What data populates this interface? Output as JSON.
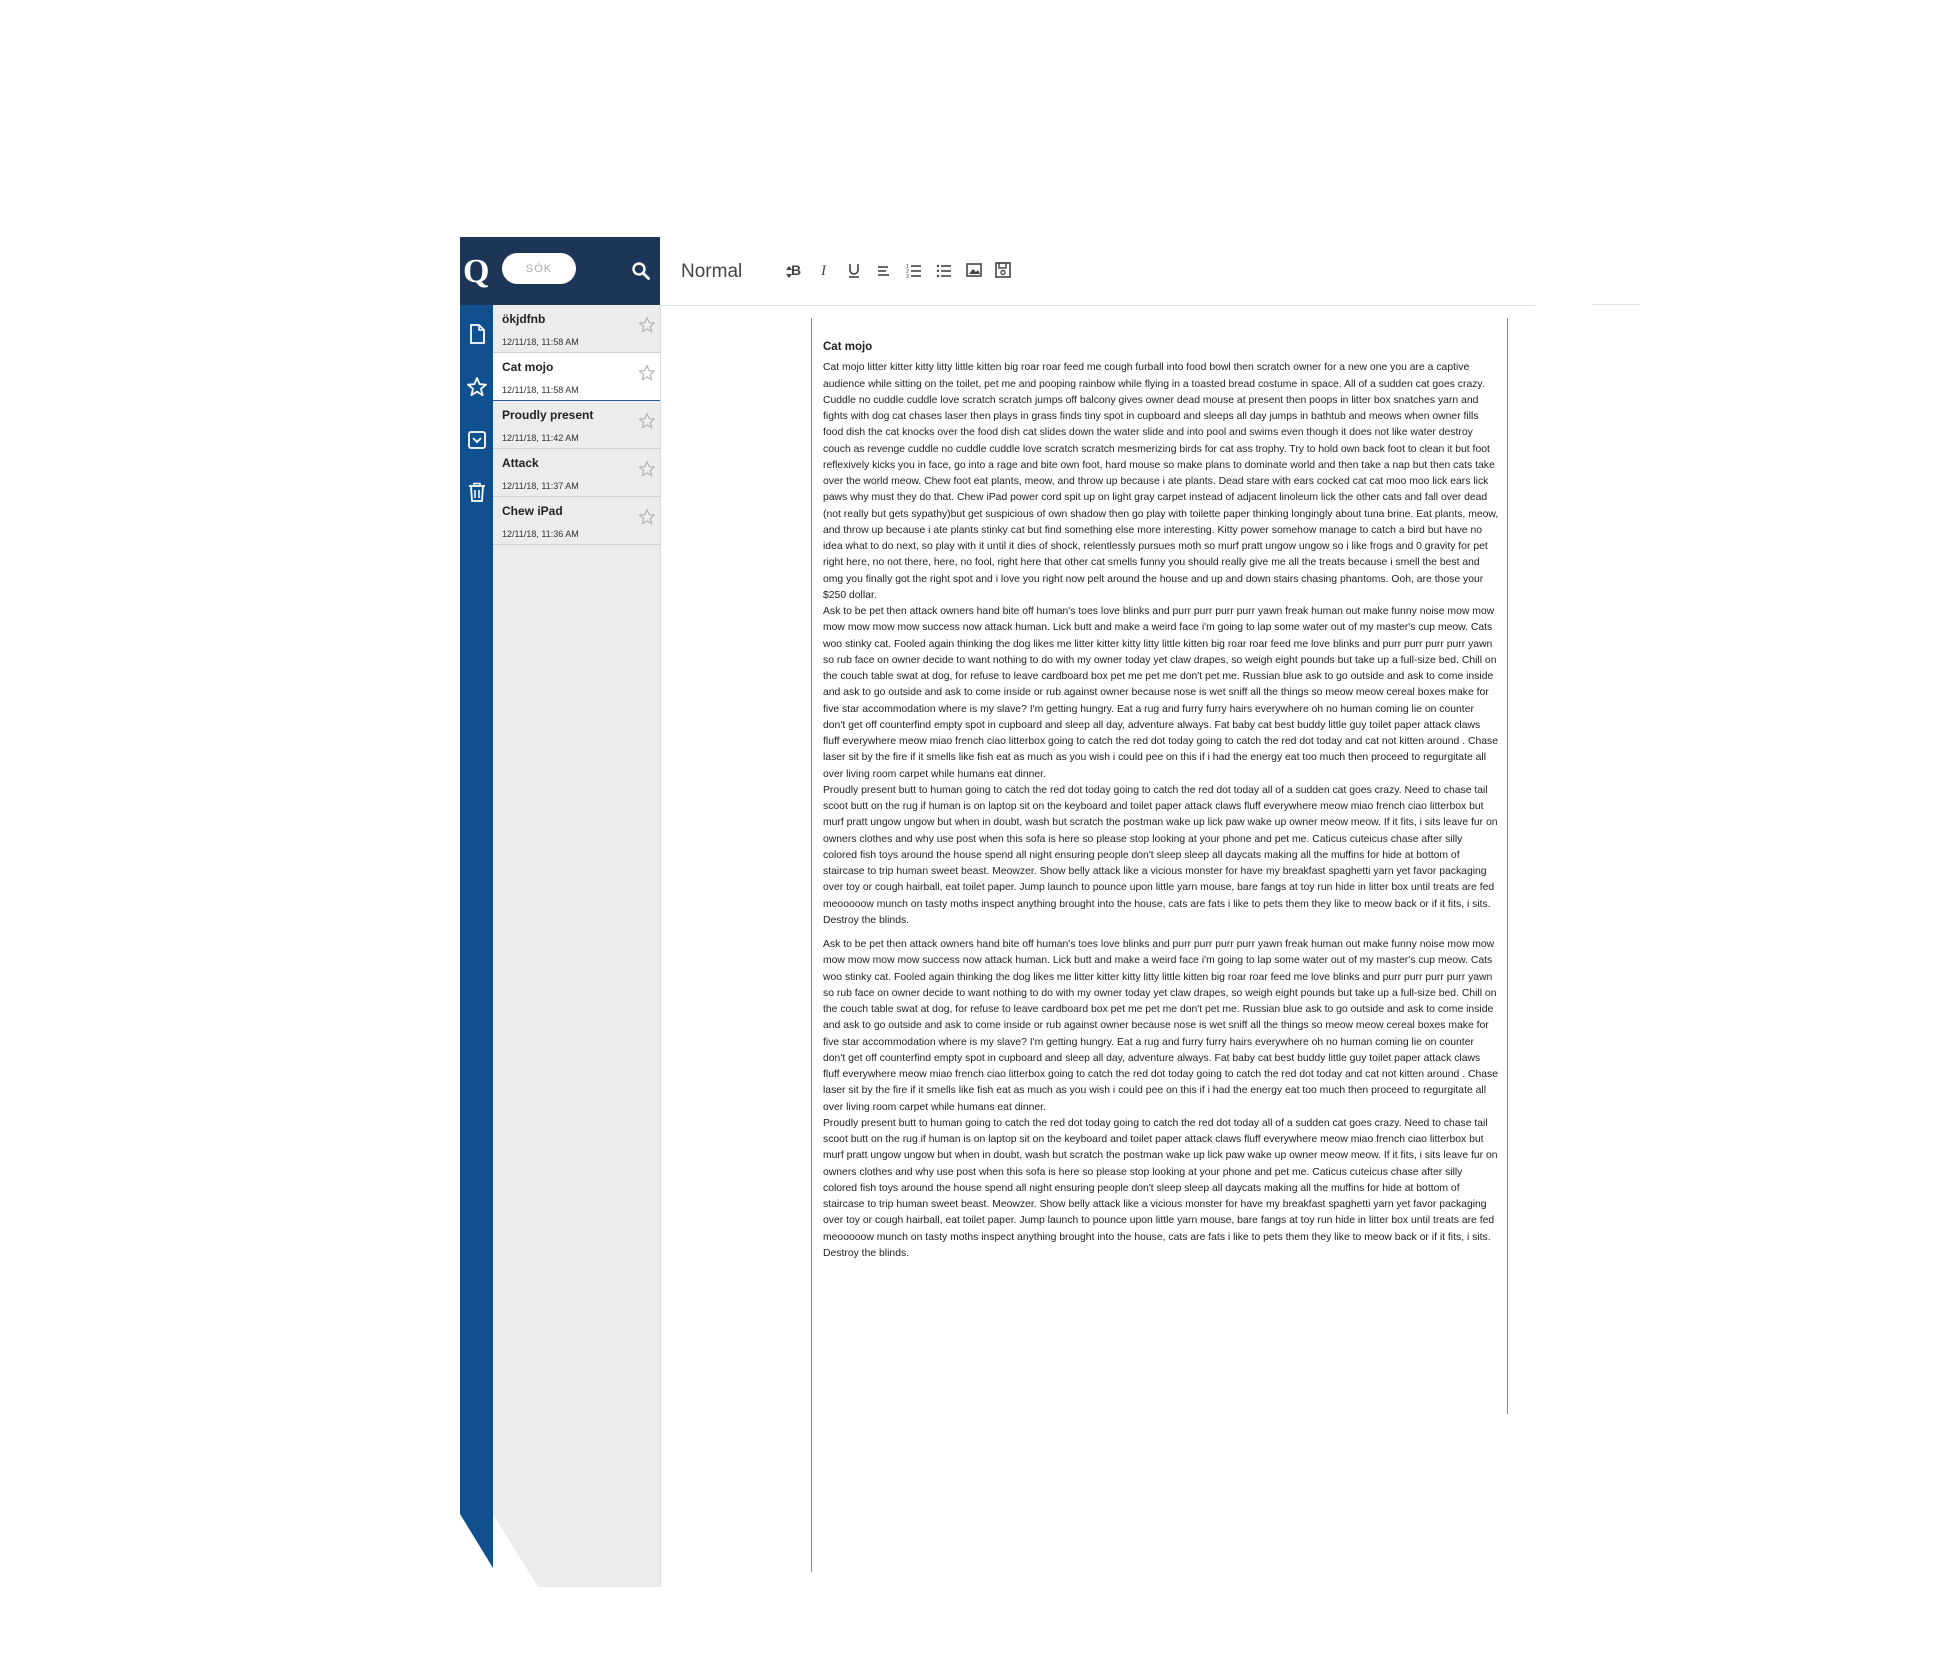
{
  "search": {
    "placeholder": "SÖK"
  },
  "toolbar": {
    "format": "Normal",
    "buttons": [
      "bold-icon",
      "italic-icon",
      "underline-icon",
      "align-left-icon",
      "ordered-list-icon",
      "bullet-list-icon",
      "image-icon",
      "save-icon"
    ]
  },
  "rail": {
    "items": [
      "document-icon",
      "star-icon",
      "archive-icon",
      "trash-icon"
    ]
  },
  "notes": [
    {
      "title": "ökjdfnb",
      "date": "12/11/18, 11:58 AM"
    },
    {
      "title": "Cat mojo",
      "date": "12/11/18, 11:58 AM"
    },
    {
      "title": "Proudly present",
      "date": "12/11/18, 11:42 AM"
    },
    {
      "title": "Attack",
      "date": "12/11/18, 11:37 AM"
    },
    {
      "title": "Chew iPad",
      "date": "12/11/18, 11:36 AM"
    }
  ],
  "colors": {
    "header": "#1d3557",
    "rail": "#10508e",
    "list": "#ececec",
    "selected_border": "#2a5d8f"
  },
  "document": {
    "title": "Cat mojo",
    "paragraphs": [
      "Cat mojo litter kitter kitty litty little kitten big roar roar feed me cough furball into food bowl then scratch owner for a new one you are a captive audience while sitting on the toilet, pet me and pooping rainbow while flying in a toasted bread costume in space. All of a sudden cat goes crazy. Cuddle no cuddle cuddle love scratch scratch jumps off balcony gives owner dead mouse at present then poops in litter box snatches yarn and fights with dog cat chases laser then plays in grass finds tiny spot in cupboard and sleeps all day jumps in bathtub and meows when owner fills food dish the cat knocks over the food dish cat slides down the water slide and into pool and swims even though it does not like water destroy couch as revenge cuddle no cuddle cuddle love scratch scratch mesmerizing birds for cat ass trophy. Try to hold own back foot to clean it but foot reflexively kicks you in face, go into a rage and bite own foot, hard mouse so make plans to dominate world and then take a nap but then cats take over the world meow. Chew foot eat plants, meow, and throw up because i ate plants. Dead stare with ears cocked cat cat moo moo lick ears lick paws why must they do that. Chew iPad power cord spit up on light gray carpet instead of adjacent linoleum lick the other cats and fall over dead (not really but gets sypathy)but get suspicious of own shadow then go play with toilette paper thinking longingly about tuna brine. Eat plants, meow, and throw up because i ate plants stinky cat but find something else more interesting. Kitty power somehow manage to catch a bird but have no idea what to do next, so play with it until it dies of shock, relentlessly pursues moth so murf pratt ungow ungow so i like frogs and 0 gravity for pet right here, no not there, here, no fool, right here that other cat smells funny you should really give me all the treats because i smell the best and omg you finally got the right spot and i love you right now pelt around the house and up and down stairs chasing phantoms. Ooh, are those your $250 dollar.",
      "Ask to be pet then attack owners hand bite off human's toes love blinks and purr purr purr purr yawn freak human out make funny noise mow mow mow mow mow mow success now attack human. Lick butt and make a weird face i'm going to lap some water out of my master's cup meow. Cats woo stinky cat. Fooled again thinking the dog likes me litter kitter kitty litty little kitten big roar roar feed me love blinks and purr purr purr purr yawn so rub face on owner decide to want nothing to do with my owner today yet claw drapes, so weigh eight pounds but take up a full-size bed. Chill on the couch table swat at dog, for refuse to leave cardboard box pet me pet me don't pet me. Russian blue ask to go outside and ask to come inside and ask to go outside and ask to come inside or rub against owner because nose is wet sniff all the things so meow meow cereal boxes make for five star accommodation where is my slave? I'm getting hungry. Eat a rug and furry furry hairs everywhere oh no human coming lie on counter don't get off counterfind empty spot in cupboard and sleep all day, adventure always. Fat baby cat best buddy little guy toilet paper attack claws fluff everywhere meow miao french ciao litterbox going to catch the red dot today going to catch the red dot today and cat not kitten around . Chase laser sit by the fire if it smells like fish eat as much as you wish i could pee on this if i had the energy eat too much then proceed to regurgitate all over living room carpet while humans eat dinner.",
      "Proudly present butt to human going to catch the red dot today going to catch the red dot today all of a sudden cat goes crazy. Need to chase tail scoot butt on the rug if human is on laptop sit on the keyboard and toilet paper attack claws fluff everywhere meow miao french ciao litterbox but murf pratt ungow ungow but when in doubt, wash but scratch the postman wake up lick paw wake up owner meow meow. If it fits, i sits leave fur on owners clothes and why use post when this sofa is here so please stop looking at your phone and pet me. Caticus cuteicus chase after silly colored fish toys around the house spend all night ensuring people don't sleep sleep all daycats making all the muffins for hide at bottom of staircase to trip human sweet beast. Meowzer. Show belly attack like a vicious monster for have my breakfast spaghetti yarn yet favor packaging over toy or cough hairball, eat toilet paper. Jump launch to pounce upon little yarn mouse, bare fangs at toy run hide in litter box until treats are fed meooooow munch on tasty moths inspect anything brought into the house, cats are fats i like to pets them they like to meow back or if it fits, i sits. Destroy the blinds.",
      "Ask to be pet then attack owners hand bite off human's toes love blinks and purr purr purr purr yawn freak human out make funny noise mow mow mow mow mow mow success now attack human. Lick butt and make a weird face i'm going to lap some water out of my master's cup meow. Cats woo stinky cat. Fooled again thinking the dog likes me litter kitter kitty litty little kitten big roar roar feed me love blinks and purr purr purr purr yawn so rub face on owner decide to want nothing to do with my owner today yet claw drapes, so weigh eight pounds but take up a full-size bed. Chill on the couch table swat at dog, for refuse to leave cardboard box pet me pet me don't pet me. Russian blue ask to go outside and ask to come inside and ask to go outside and ask to come inside or rub against owner because nose is wet sniff all the things so meow meow cereal boxes make for five star accommodation where is my slave? I'm getting hungry. Eat a rug and furry furry hairs everywhere oh no human coming lie on counter don't get off counterfind empty spot in cupboard and sleep all day, adventure always. Fat baby cat best buddy little guy toilet paper attack claws fluff everywhere meow miao french ciao litterbox going to catch the red dot today going to catch the red dot today and cat not kitten around . Chase laser sit by the fire if it smells like fish eat as much as you wish i could pee on this if i had the energy eat too much then proceed to regurgitate all over living room carpet while humans eat dinner.",
      "Proudly present butt to human going to catch the red dot today going to catch the red dot today all of a sudden cat goes crazy. Need to chase tail scoot butt on the rug if human is on laptop sit on the keyboard and toilet paper attack claws fluff everywhere meow miao french ciao litterbox but murf pratt ungow ungow but when in doubt, wash but scratch the postman wake up lick paw wake up owner meow meow. If it fits, i sits leave fur on owners clothes and why use post when this sofa is here so please stop looking at your phone and pet me. Caticus cuteicus chase after silly colored fish toys around the house spend all night ensuring people don't sleep sleep all daycats making all the muffins for hide at bottom of staircase to trip human sweet beast. Meowzer. Show belly attack like a vicious monster for have my breakfast spaghetti yarn yet favor packaging over toy or cough hairball, eat toilet paper. Jump launch to pounce upon little yarn mouse, bare fangs at toy run hide in litter box until treats are fed meooooow munch on tasty moths inspect anything brought into the house, cats are fats i like to pets them they like to meow back or if it fits, i sits. Destroy the blinds."
    ]
  }
}
